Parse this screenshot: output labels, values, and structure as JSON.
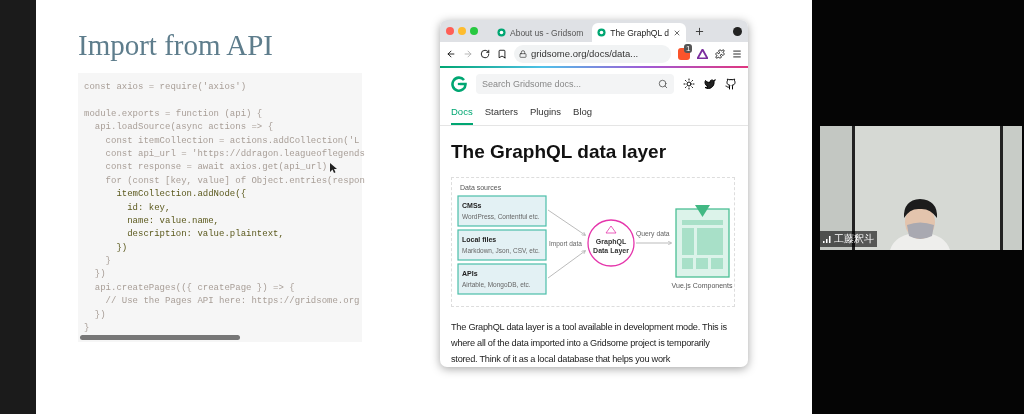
{
  "slide": {
    "title": "Import from API",
    "code_lines": [
      {
        "kind": "code",
        "text": "const axios = require('axios')",
        "highlighted": false
      },
      {
        "kind": "blank"
      },
      {
        "kind": "code",
        "text": "module.exports = function (api) {",
        "highlighted": false
      },
      {
        "kind": "code",
        "text": "  api.loadSource(async actions => {",
        "highlighted": false
      },
      {
        "kind": "code",
        "text": "    const itemCollection = actions.addCollection('L",
        "highlighted": false
      },
      {
        "kind": "code",
        "text": "    const api_url = 'https://ddragon.leagueoflegends",
        "highlighted": false
      },
      {
        "kind": "code",
        "text": "    const response = await axios.get(api_url)",
        "highlighted": false
      },
      {
        "kind": "code",
        "text": "    for (const [key, value] of Object.entries(respon",
        "highlighted": false
      },
      {
        "kind": "code",
        "text": "      itemCollection.addNode({",
        "highlighted": true
      },
      {
        "kind": "code",
        "text": "        id: key,",
        "highlighted": true
      },
      {
        "kind": "code",
        "text": "        name: value.name,",
        "highlighted": true
      },
      {
        "kind": "code",
        "text": "        description: value.plaintext,",
        "highlighted": true
      },
      {
        "kind": "code",
        "text": "      })",
        "highlighted": true
      },
      {
        "kind": "code",
        "text": "    }",
        "highlighted": false
      },
      {
        "kind": "code",
        "text": "  })",
        "highlighted": false
      },
      {
        "kind": "code",
        "text": "  api.createPages(({ createPage }) => {",
        "highlighted": false
      },
      {
        "kind": "code",
        "text": "    // Use the Pages API here: https://gridsome.org",
        "highlighted": false
      },
      {
        "kind": "code",
        "text": "  })",
        "highlighted": false
      },
      {
        "kind": "code",
        "text": "}",
        "highlighted": false
      }
    ]
  },
  "browser": {
    "tabs": [
      {
        "label": "About us - Gridsom",
        "selected": false
      },
      {
        "label": "The GraphQL d",
        "selected": true
      }
    ],
    "url": "gridsome.org/docs/data...",
    "extension_badge": "1",
    "search": {
      "placeholder": "Search Gridsome docs..."
    },
    "nav": [
      {
        "label": "Docs",
        "selected": true
      },
      {
        "label": "Starters",
        "selected": false
      },
      {
        "label": "Plugins",
        "selected": false
      },
      {
        "label": "Blog",
        "selected": false
      }
    ],
    "heading": "The GraphQL data layer",
    "diagram": {
      "group_label": "Data sources",
      "sources": [
        {
          "title": "CMSs",
          "subtitle": "WordPress, Contentful etc."
        },
        {
          "title": "Local files",
          "subtitle": "Markdown, Json, CSV, etc."
        },
        {
          "title": "APIs",
          "subtitle": "Airtable,  MongoDB, etc."
        }
      ],
      "import_label": "Import data",
      "hub_lines": [
        "GraphQL",
        "Data Layer"
      ],
      "query_label": "Query data",
      "target_label": "Vue.js Components"
    },
    "paragraph": "The GraphQL data layer is a tool available in development mode. This is where all of the data imported into a Gridsome project is temporarily stored. Think of it as a local database that helps you work"
  },
  "participant": {
    "name": "工藤釈斗"
  }
}
